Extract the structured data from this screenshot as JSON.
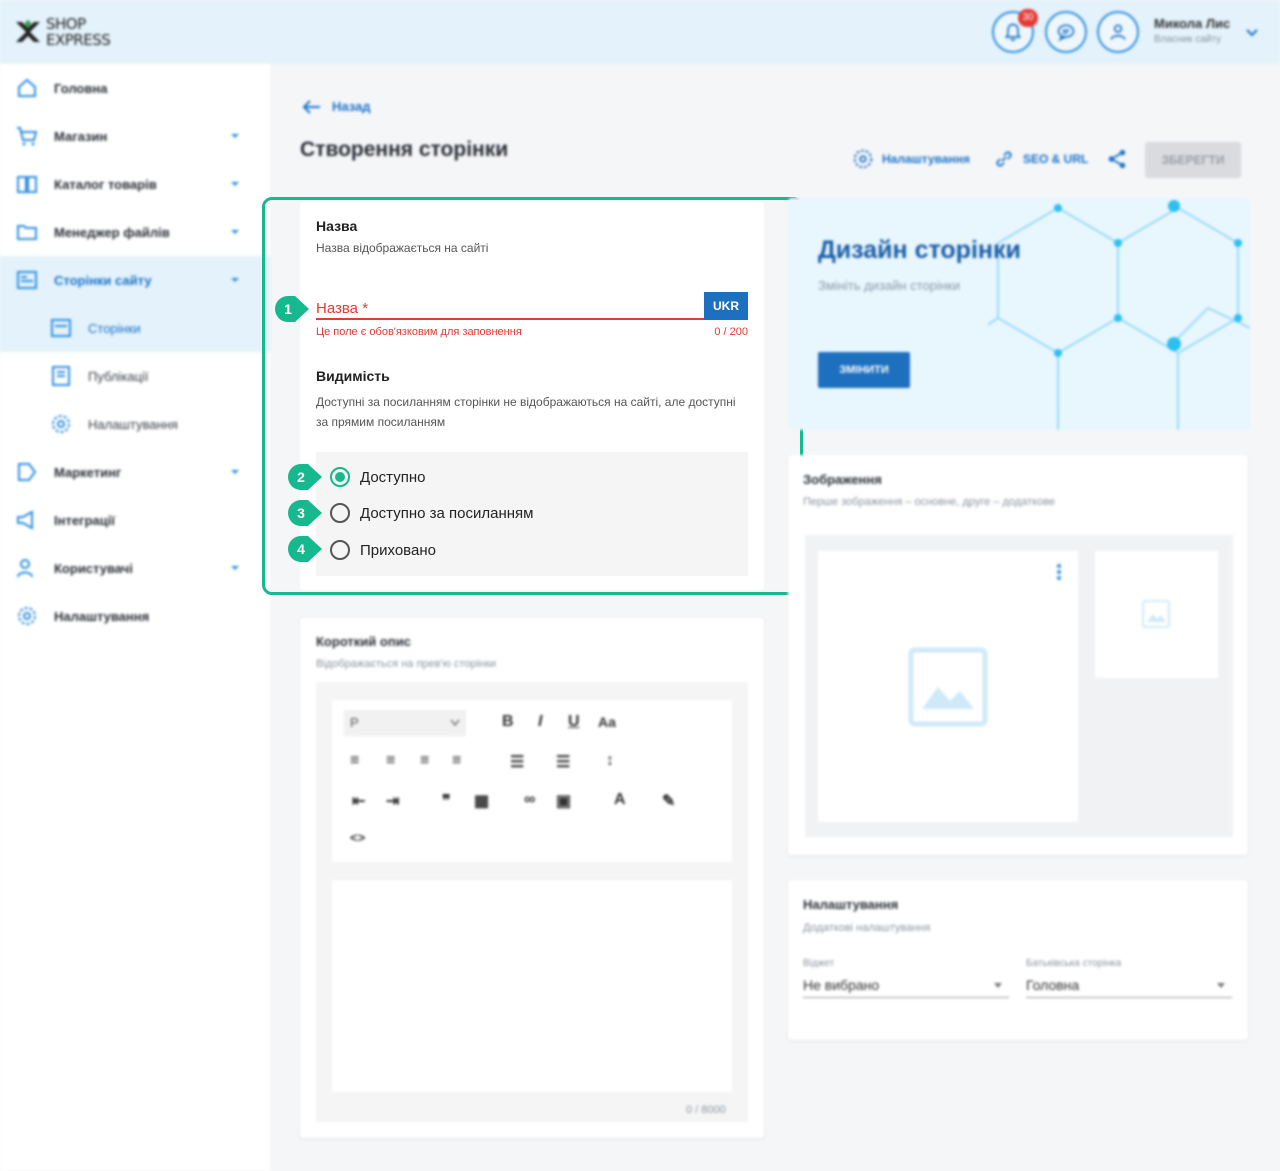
{
  "header": {
    "logo": {
      "line1": "SHOP",
      "line2": "EXPRESS"
    },
    "notification_count": "30",
    "user_name": "Микола Лис",
    "user_role": "Власник сайту"
  },
  "sidebar": {
    "items": [
      {
        "label": "Головна"
      },
      {
        "label": "Магазин"
      },
      {
        "label": "Каталог товарів"
      },
      {
        "label": "Менеджер файлів"
      },
      {
        "label": "Сторінки сайту"
      },
      {
        "label": "Сторінки"
      },
      {
        "label": "Публікації"
      },
      {
        "label": "Налаштування"
      },
      {
        "label": "Маркетинг"
      },
      {
        "label": "Інтеграції"
      },
      {
        "label": "Користувачі"
      },
      {
        "label": "Налаштування"
      }
    ]
  },
  "main": {
    "back_label": "Назад",
    "title": "Створення сторінки",
    "toolbar": {
      "settings": "Налаштування",
      "seo": "SEO & URL",
      "save": "ЗБЕРЕГТИ"
    },
    "name_section": {
      "title": "Назва",
      "subtitle": "Назва відображається на сайті",
      "placeholder": "Назва *",
      "lang": "UKR",
      "error": "Це поле є обов'язковим для заповнення",
      "counter": "0 / 200"
    },
    "visibility": {
      "title": "Видимість",
      "description": "Доступні за посиланням сторінки не відображаються на сайті, але доступні за прямим посиланням",
      "options": [
        {
          "label": "Доступно",
          "step": "2",
          "selected": true
        },
        {
          "label": "Доступно за посиланням",
          "step": "3",
          "selected": false
        },
        {
          "label": "Приховано",
          "step": "4",
          "selected": false
        }
      ],
      "name_step": "1"
    },
    "short_desc": {
      "title": "Короткий опис",
      "subtitle": "Відображається на прев'ю сторінки",
      "format": "P",
      "counter": "0 / 8000"
    },
    "design": {
      "title": "Дизайн сторінки",
      "subtitle": "Змініть дизайн сторінки",
      "button": "ЗМІНИТИ"
    },
    "images": {
      "title": "Зображення",
      "subtitle": "Перше зображення – основне, друге – додаткове"
    },
    "settings": {
      "title": "Налаштування",
      "subtitle": "Додаткові налаштування",
      "widget_label": "Віджет",
      "widget_value": "Не вибрано",
      "parent_label": "Батьківська сторінка",
      "parent_value": "Головна"
    }
  },
  "colors": {
    "accent": "#1d6fbf",
    "highlight": "#16b88d",
    "error": "#e53935"
  }
}
